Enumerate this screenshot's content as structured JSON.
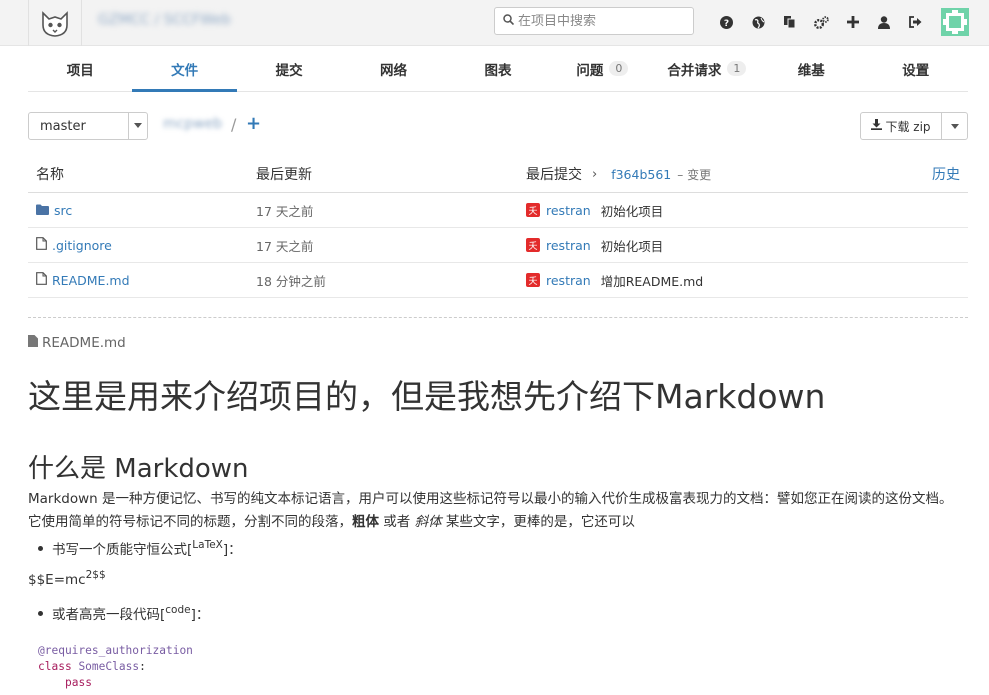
{
  "header": {
    "breadcrumb": "GZMCC / SCCFWeb",
    "search_placeholder": "在项目中搜索",
    "icons": [
      "help-icon",
      "globe-icon",
      "copy-icon",
      "gears-icon",
      "plus-icon",
      "user-icon",
      "logout-icon"
    ]
  },
  "nav": {
    "tabs": [
      {
        "label": "项目"
      },
      {
        "label": "文件"
      },
      {
        "label": "提交"
      },
      {
        "label": "网络"
      },
      {
        "label": "图表"
      },
      {
        "label": "问题",
        "badge": "0"
      },
      {
        "label": "合并请求",
        "badge": "1"
      },
      {
        "label": "维基"
      },
      {
        "label": "设置"
      }
    ],
    "active": "文件"
  },
  "toolbar": {
    "branch": "master",
    "repo_path": "mcpweb",
    "slash": "/",
    "add": "+",
    "download_label": "下载 zip"
  },
  "files": {
    "headers": {
      "name": "名称",
      "updated": "最后更新",
      "last_commit": "最后提交",
      "sha": "f364b561",
      "sha_suffix": "– 变更",
      "history": "历史"
    },
    "rows": [
      {
        "name": "src",
        "updated": "17 天之前",
        "author": "restran",
        "message": "初始化项目"
      },
      {
        "name": ".gitignore",
        "updated": "17 天之前",
        "author": "restran",
        "message": "初始化项目"
      },
      {
        "name": "README.md",
        "updated": "18 分钟之前",
        "author": "restran",
        "message": "增加README.md"
      }
    ]
  },
  "readme": {
    "filename": "README.md",
    "h1": "这里是用来介绍项目的，但是我想先介绍下Markdown",
    "h2": "什么是 Markdown",
    "para_a": "Markdown 是一种方便记忆、书写的纯文本标记语言，用户可以使用这些标记符号以最小的输入代价生成极富表现力的文档：譬如您正在阅读的这份文档。它使用简单的符号标记不同的标题，分割不同的段落，",
    "para_bold": "粗体",
    "para_mid": " 或者 ",
    "para_italic": "斜体",
    "para_b": " 某些文字，更棒的是，它还可以",
    "bullet1": "书写一个质能守恒公式[",
    "bullet1_sup": "LaTeX",
    "bullet1_end": "]：",
    "math": "$$E=mc",
    "math_sup": "2$$",
    "bullet2": "或者高亮一段代码[",
    "bullet2_sup": "code",
    "bullet2_end": "]：",
    "code": {
      "decorator": "@requires_authorization",
      "kw_class": "class",
      "class_name": "SomeClass",
      "colon": ":",
      "pass": "pass"
    }
  }
}
